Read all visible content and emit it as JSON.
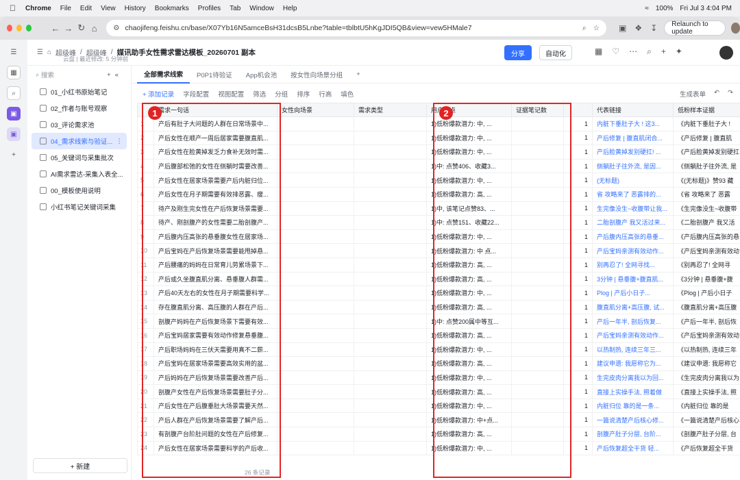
{
  "macbar": {
    "app": "Chrome",
    "menus": [
      "File",
      "Edit",
      "View",
      "History",
      "Bookmarks",
      "Profiles",
      "Tab",
      "Window",
      "Help"
    ],
    "battery": "100%",
    "datetime": "Fri Jul 3  4:04 PM"
  },
  "browser": {
    "url": "chaojifeng.feishu.cn/base/X07Yb16N5amceBsH31dcsB5Lnbe?table=tblbtU5hKgJDI5QB&view=vew5HMale7",
    "relaunch": "Relaunch to update"
  },
  "header": {
    "crumb1": "超级峰",
    "crumb2": "超级峰",
    "title": "媒讯助手女性需求雷达模板_20260701 副本",
    "location": "云盘",
    "modified": "最近修改: 5 分钟前",
    "share": "分享",
    "automation": "自动化"
  },
  "sidebar": {
    "search": "搜索",
    "items": [
      {
        "label": "01_小红书原始笔记"
      },
      {
        "label": "02_作者与账号观察"
      },
      {
        "label": "03_评论需求池"
      },
      {
        "label": "04_需求线索与验证..."
      },
      {
        "label": "05_关键词与采集批次"
      },
      {
        "label": "AI需求雷达-采集入表全..."
      },
      {
        "label": "00_模板使用说明"
      },
      {
        "label": "小红书笔记关键词采集"
      }
    ],
    "new_label": "+ 新建"
  },
  "tabs": [
    "全部需求线索",
    "P0P1待验证",
    "App机会池",
    "按女性向场景分组"
  ],
  "toolbar": {
    "add": "+ 添加记录",
    "fields": "字段配置",
    "view": "视图配置",
    "filter": "筛选",
    "group": "分组",
    "sort": "排序",
    "rowh": "行高",
    "fill": "填色",
    "form": "生成表单"
  },
  "columns": [
    "需求一句话",
    "女性向场景",
    "需求类型",
    "用户痛点",
    "证据笔记数",
    "代表链接",
    "低粉样本证据"
  ],
  "rows": [
    [
      "产后有肚子大问题的人群在日常场景中...",
      "1)低粉爆款潜力: 中, ...",
      "1",
      "内脏下垂肚子大 ! 这3...",
      "《内脏下垂肚子大 !"
    ],
    [
      "产后女性在顺产一周后居家需要腹直肌...",
      "1)低粉爆款潜力: 中, ...",
      "1",
      "产后修复 | 腹直肌闭合...",
      "《产后修复 | 腹直肌"
    ],
    [
      "产后女性在脸黄掉发乏力食补无效时需...",
      "1)低粉爆款潜力: 中, ...",
      "1",
      "产后脸黄掉发别硬扛! ...",
      "《产后脸黄掉发别硬扛"
    ],
    [
      "产后腹部松弛的女性在侧躺时需要改善...",
      "1)中: 点赞406、收藏3...",
      "1",
      "侧躺肚子往外流, 是因...",
      "《侧躺肚子往外流, 是"
    ],
    [
      "产后女性在居家场景需要产后内脏归位...",
      "1)低粉爆款潜力: 中, ...",
      "1",
      "(无标题)",
      "《(无标题)》赞93 藏"
    ],
    [
      "产后女性在月子期需要有效排恶露、瘦...",
      "1)低粉爆款潜力: 高, ...",
      "1",
      "省 攻略来了 恶露排的...",
      "《省 攻略来了 恶露"
    ],
    [
      "待产及刚生完女性在产后恢复场景需要...",
      "1)中, 该笔记点赞83、...",
      "1",
      "生完像没生~收腹带让我...",
      "《生完像没生~收腹带"
    ],
    [
      "待产、刚剖腹产的女性需要二胎剖腹产...",
      "1)中: 点赞151、收藏22...",
      "1",
      "二胎剖腹产 我又活过来...",
      "《二胎剖腹产 我又活"
    ],
    [
      "产后腹内压高张的悬垂腹女性在居家场...",
      "1)低粉爆款潜力: 中, ...",
      "1",
      "产后腹内压高张的悬垂...",
      "《产后腹内压高张的悬"
    ],
    [
      "产后宝妈在产后恢复场景需要能甩掉悬...",
      "1)低粉爆款潜力: 中 点...",
      "1",
      "产后宝妈亲测有效动作...",
      "《产后宝妈亲测有效动"
    ],
    [
      "产后腰痛的妈妈在日常育儿劳累场景下...",
      "1)低粉爆款潜力: 高, ...",
      "1",
      "别再忍了! 全网寻找...",
      "《别再忍了! 全网寻"
    ],
    [
      "产后或久坐腹直肌分离、悬垂腹人群需...",
      "1)低粉爆款潜力: 高, ...",
      "1",
      "3分钟 | 悬垂腹+腹直肌...",
      "《3分钟 | 悬垂腹+腹"
    ],
    [
      "产后40天左右的女性在月子期需要科学...",
      "1)低粉爆款潜力: 中, ...",
      "1",
      "Plog | 产后小日子...",
      "《Plog | 产后小日子"
    ],
    [
      "存在腹直肌分离、高压腹的人群在产后...",
      "1)低粉爆款潜力: 高, ...",
      "1",
      "腹直肌分离+高压腹, 试...",
      "《腹直肌分离+高压腹"
    ],
    [
      "剖腹产妈妈在产后恢复场景下需要有效...",
      "1)中: 点赞200属中等互...",
      "1",
      "产后一年半, 剖后恢复...",
      "《产后一年半, 剖后恢"
    ],
    [
      "产后宝妈居家需要有效动作修复悬垂腹...",
      "1)低粉爆款潜力: 高, ...",
      "1",
      "产后宝妈亲测有效动作...",
      "《产后宝妈亲测有效动"
    ],
    [
      "产后职场妈妈在三伏天需要用真不二薪...",
      "1)低粉爆款潜力: 中, ...",
      "1",
      "以热制热, 连续三年三...",
      "《以热制热, 连续三年"
    ],
    [
      "产后宝妈在居家场景需要高效实用的盆...",
      "1)低粉爆款潜力: 高, ...",
      "1",
      "建议申遗: 我愿称它为...",
      "《建议申遗: 我愿称它"
    ],
    [
      "产后妈妈在产后恢复场景需要改善产后...",
      "1)低粉爆款潜力: 中, ...",
      "1",
      "生完皮肉分离我以为回...",
      "《生完皮肉分离我以为"
    ],
    [
      "剖腹产女性在产后恢复场景需要肚子分...",
      "1)低粉爆款潜力: 高, ...",
      "1",
      "直接上实操手法, 照着做",
      "《直接上实操手法, 照"
    ],
    [
      "产后女性在产后腹垂肚大场景需要天然...",
      "1)低粉爆款潜力: 中, ...",
      "1",
      "内脏归位 靠的是一条...",
      "《内脏归位 靠的是"
    ],
    [
      "产后人群在产后恢复场景需要了解产后...",
      "1)低粉爆款潜力: 中+点...",
      "1",
      "一篇说清楚产后核心修...",
      "《一篇说清楚产后核心"
    ],
    [
      "有剖腹产台阶肚问题的女性在产后修复...",
      "1)低粉爆款潜力: 高, ...",
      "1",
      "剖腹产肚子分层, 台阶...",
      "《剖腹产肚子分层, 台"
    ],
    [
      "产后女性在居家场景需要科学的产后收...",
      "1)低粉爆款潜力: 中, ...",
      "1",
      "产后恢复超全干货 轻...",
      "《产后恢复超全干货"
    ]
  ],
  "badges": [
    "1",
    "2"
  ],
  "footer": "26 条记录"
}
